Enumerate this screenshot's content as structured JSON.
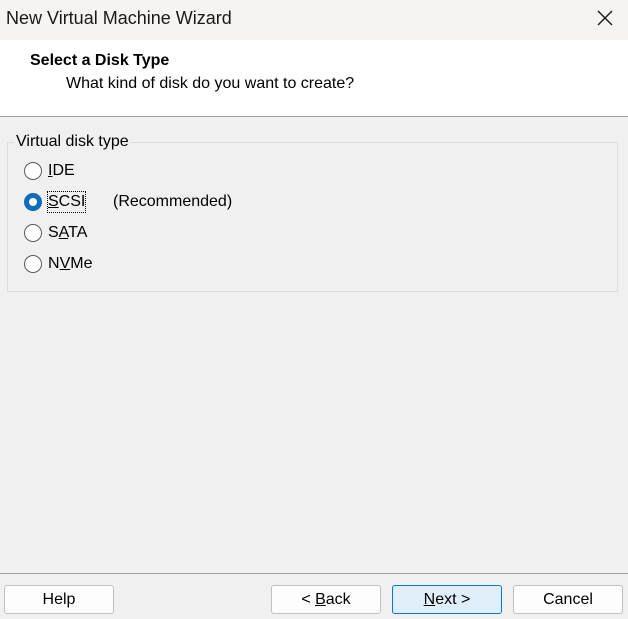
{
  "window": {
    "title": "New Virtual Machine Wizard",
    "close_icon": "close-icon"
  },
  "header": {
    "title": "Select a Disk Type",
    "subtitle": "What kind of disk do you want to create?"
  },
  "disk_type_group": {
    "legend": "Virtual disk type",
    "selected": "SCSI",
    "options": [
      {
        "label": "IDE",
        "mnemonic_index": 0,
        "checked": false,
        "note": ""
      },
      {
        "label": "SCSI",
        "mnemonic_index": 0,
        "checked": true,
        "note": "(Recommended)"
      },
      {
        "label": "SATA",
        "mnemonic_index": 1,
        "checked": false,
        "note": ""
      },
      {
        "label": "NVMe",
        "mnemonic_index": 1,
        "checked": false,
        "note": ""
      }
    ]
  },
  "buttons": {
    "help": "Help",
    "back": "< Back",
    "next": "Next >",
    "cancel": "Cancel"
  },
  "colors": {
    "accent": "#0f6cbd",
    "default_button_border": "#0078d4",
    "default_button_fill": "#e0eef9",
    "titlebar": "#f7f3f0",
    "background": "#f0f0f0"
  }
}
